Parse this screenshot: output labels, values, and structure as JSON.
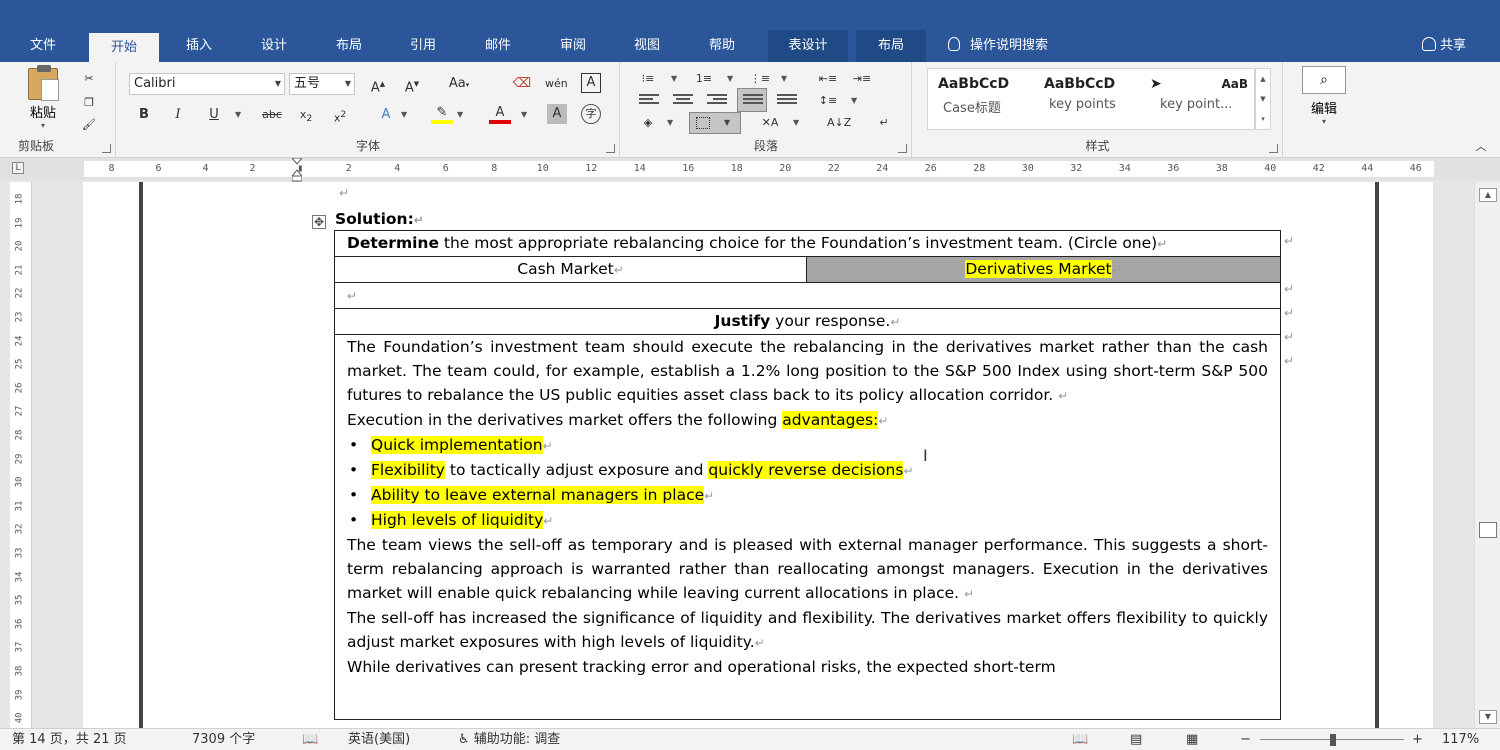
{
  "tabs": [
    {
      "id": "file",
      "label": "文件"
    },
    {
      "id": "home",
      "label": "开始"
    },
    {
      "id": "insert",
      "label": "插入"
    },
    {
      "id": "design",
      "label": "设计"
    },
    {
      "id": "layout",
      "label": "布局"
    },
    {
      "id": "references",
      "label": "引用"
    },
    {
      "id": "mailings",
      "label": "邮件"
    },
    {
      "id": "review",
      "label": "审阅"
    },
    {
      "id": "view",
      "label": "视图"
    },
    {
      "id": "help",
      "label": "帮助"
    },
    {
      "id": "table-design",
      "label": "表设计"
    },
    {
      "id": "table-layout",
      "label": "布局"
    }
  ],
  "tell_me": "操作说明搜索",
  "share": "共享",
  "ribbon": {
    "clipboard": {
      "paste": "粘贴",
      "label": "剪贴板"
    },
    "font": {
      "name": "Calibri",
      "size": "五号",
      "label": "字体"
    },
    "paragraph": {
      "label": "段落"
    },
    "styles": {
      "label": "样式",
      "items": [
        {
          "sample": "AaBbCcD",
          "name": "Case标题"
        },
        {
          "sample": "AaBbCcD",
          "name": "key points"
        },
        {
          "sample": "AaB",
          "name": "key point..."
        }
      ]
    },
    "editing": {
      "label": "编辑"
    }
  },
  "ruler": [
    "8",
    "6",
    "4",
    "2",
    "",
    "2",
    "4",
    "6",
    "8",
    "10",
    "12",
    "14",
    "16",
    "18",
    "20",
    "22",
    "24",
    "26",
    "28",
    "30",
    "32",
    "34",
    "36",
    "38",
    "40",
    "42",
    "44",
    "46"
  ],
  "vruler": [
    "18",
    "19",
    "20",
    "21",
    "22",
    "23",
    "24",
    "25",
    "26",
    "27",
    "28",
    "29",
    "30",
    "31",
    "32",
    "33",
    "34",
    "35",
    "36",
    "37",
    "38",
    "39",
    "40"
  ],
  "document": {
    "solution": "Solution:",
    "determine_bold": "Determine",
    "determine_rest": " the most appropriate rebalancing choice for the Foundation’s investment team. (Circle one)",
    "cash_market": "Cash Market",
    "derivatives_market": "Derivatives Market",
    "justify_bold": "Justify",
    "justify_rest": " your response.",
    "p1": "The Foundation’s investment team should execute the rebalancing in the derivatives market rather than the cash market. The team could, for example, establish a 1.2% long position to the S&P 500 Index using short-term S&P 500 futures to rebalance the US public equities asset class back to its policy allocation corridor.",
    "p2_pre": "Execution in the derivatives market offers the following ",
    "p2_hl": "advantages:",
    "bullet1": "Quick implementation",
    "bullet2_hl1": "Flexibility",
    "bullet2_mid": " to tactically adjust exposure and ",
    "bullet2_hl2": "quickly reverse decisions",
    "bullet3": "Ability to leave external managers in place",
    "bullet4": "High levels of liquidity",
    "p3": "The team views the sell-off as temporary and is pleased with external manager performance. This suggests a short-term rebalancing approach is warranted rather than reallocating amongst managers. Execution in the derivatives market will enable quick rebalancing while leaving current allocations in place.",
    "p4": "The sell-off has increased the significance of liquidity and flexibility. The derivatives market offers flexibility to quickly adjust market exposures with high levels of liquidity.",
    "p5": "While derivatives can present tracking error and operational risks, the expected short-term"
  },
  "status": {
    "page": "第 14 页，共 21 页",
    "words": "7309 个字",
    "language": "英语(美国)",
    "accessibility": "辅助功能: 调查",
    "zoom": "117%"
  }
}
